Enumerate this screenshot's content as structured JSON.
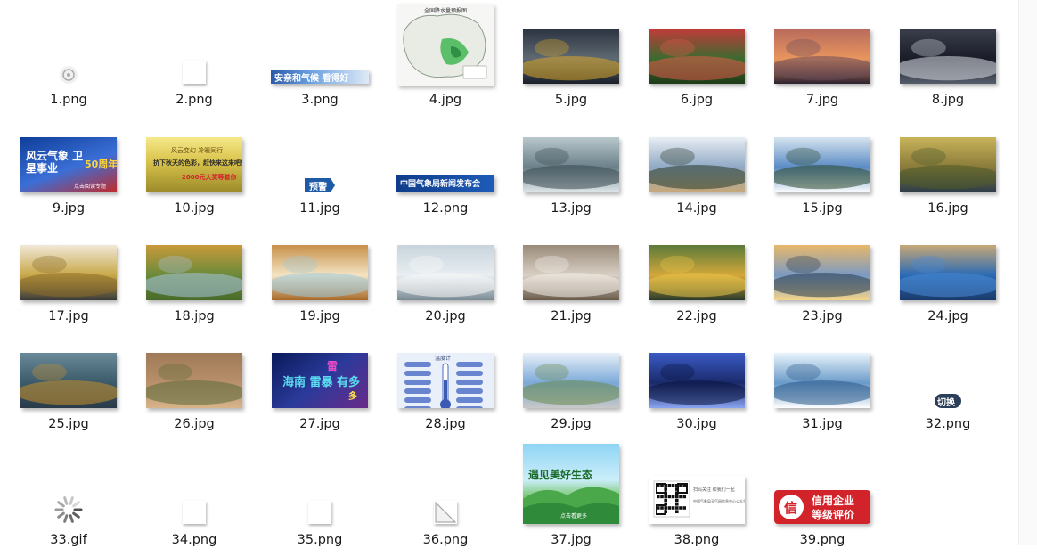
{
  "files": [
    {
      "name": "1.png",
      "kind": "icon-tiny"
    },
    {
      "name": "2.png",
      "kind": "blank-small"
    },
    {
      "name": "3.png",
      "kind": "banner-strip",
      "overlay_text": "安亲和气候 看得好"
    },
    {
      "name": "4.jpg",
      "kind": "map",
      "overlay_text": "全国降水量预报图"
    },
    {
      "name": "5.jpg",
      "kind": "photo",
      "palette": [
        "#5f6a72",
        "#2b3340",
        "#d9a628",
        "#1a1f28"
      ],
      "subject": "motorcycle-rider-yellow-hat"
    },
    {
      "name": "6.jpg",
      "kind": "photo",
      "palette": [
        "#3b6b2f",
        "#c23a3a",
        "#e35a4a",
        "#1f3b18"
      ],
      "subject": "red-berries-tree"
    },
    {
      "name": "7.jpg",
      "kind": "photo",
      "palette": [
        "#e8955e",
        "#b86a5c",
        "#6a4a5a",
        "#2c2230"
      ],
      "subject": "sunset-horses"
    },
    {
      "name": "8.jpg",
      "kind": "photo",
      "palette": [
        "#1a1d28",
        "#3a3f4c",
        "#d8dde4",
        "#555d6a"
      ],
      "subject": "satellite-clouds"
    },
    {
      "name": "9.jpg",
      "kind": "poster",
      "overlay_text": "风云气象 卫星事业",
      "overlay_text2": "50周年",
      "overlay_text3": "点击阅读专题"
    },
    {
      "name": "10.jpg",
      "kind": "poster",
      "overlay_text": "抗下秋天的色彩，赶快来这来吧！",
      "overlay_text2": "2000元大奖等着你",
      "overlay_text3": "风云变幻 冷暖同行"
    },
    {
      "name": "11.jpg",
      "kind": "badge",
      "overlay_text": "预警"
    },
    {
      "name": "12.png",
      "kind": "banner-blue",
      "overlay_text": "中国气象局新闻发布会"
    },
    {
      "name": "13.jpg",
      "kind": "photo",
      "palette": [
        "#6a7f8a",
        "#b8c8cc",
        "#3a4a50",
        "#e0e8ea"
      ],
      "subject": "misty-valley"
    },
    {
      "name": "14.jpg",
      "kind": "photo",
      "palette": [
        "#8fa8c4",
        "#e8eef4",
        "#2a3a28",
        "#c8a878"
      ],
      "subject": "sky-clouds-lake"
    },
    {
      "name": "15.jpg",
      "kind": "photo",
      "palette": [
        "#5a8ac4",
        "#d6e4f0",
        "#2d4a2a",
        "#ffffff"
      ],
      "subject": "blue-sky-clouds"
    },
    {
      "name": "16.jpg",
      "kind": "photo",
      "palette": [
        "#8a7a3a",
        "#c8b45a",
        "#4a5a2a",
        "#2a3a48"
      ],
      "subject": "rice-harvest"
    },
    {
      "name": "17.jpg",
      "kind": "photo",
      "palette": [
        "#c8a848",
        "#f0e8d8",
        "#8a6a28",
        "#3a3a3a"
      ],
      "subject": "tea-jar"
    },
    {
      "name": "18.jpg",
      "kind": "photo",
      "palette": [
        "#6a8a3a",
        "#c89a3a",
        "#a8c4e0",
        "#4a6a2a"
      ],
      "subject": "autumn-hills"
    },
    {
      "name": "19.jpg",
      "kind": "photo",
      "palette": [
        "#f4e4c4",
        "#c8904a",
        "#9cc8d8",
        "#a86a2a"
      ],
      "subject": "mooncakes"
    },
    {
      "name": "20.jpg",
      "kind": "photo",
      "palette": [
        "#e8eef2",
        "#c8d4dc",
        "#f8f8f8",
        "#7a8a94"
      ],
      "subject": "person-sneezing"
    },
    {
      "name": "21.jpg",
      "kind": "photo",
      "palette": [
        "#d8d0c4",
        "#9a8a7a",
        "#f4efe8",
        "#6a5a4a"
      ],
      "subject": "knit-and-coffee"
    },
    {
      "name": "22.jpg",
      "kind": "photo",
      "palette": [
        "#d4a83a",
        "#5a7a3a",
        "#e8c44a",
        "#2a3a2a"
      ],
      "subject": "autumn-leaves"
    },
    {
      "name": "23.jpg",
      "kind": "photo",
      "palette": [
        "#7a9ac4",
        "#e8b86a",
        "#2a3a4a",
        "#f4d48a"
      ],
      "subject": "golden-buddha"
    },
    {
      "name": "24.jpg",
      "kind": "photo",
      "palette": [
        "#2a6ab4",
        "#c8a878",
        "#4a8ad4",
        "#1a3a6a"
      ],
      "subject": "castle-lake"
    },
    {
      "name": "25.jpg",
      "kind": "photo",
      "palette": [
        "#3a5a6a",
        "#6a8a9a",
        "#c8902a",
        "#2a3a48"
      ],
      "subject": "flooded-pavilion"
    },
    {
      "name": "26.jpg",
      "kind": "photo",
      "palette": [
        "#b8906a",
        "#a07a58",
        "#5a6a3a",
        "#d8b48a"
      ],
      "subject": "dust-storm-tower"
    },
    {
      "name": "27.jpg",
      "kind": "poster",
      "overlay_text": "海南 雷暴 有多",
      "overlay_text2": "雷",
      "overlay_text3": "多"
    },
    {
      "name": "28.jpg",
      "kind": "infographic",
      "overlay_text": "温度计"
    },
    {
      "name": "29.jpg",
      "kind": "photo",
      "palette": [
        "#7aa8d8",
        "#e8f0f8",
        "#6a8a4a",
        "#c8c8c8"
      ],
      "subject": "greenhouses"
    },
    {
      "name": "30.jpg",
      "kind": "photo",
      "palette": [
        "#1a2a6a",
        "#3a5ac4",
        "#0a1440",
        "#8aa4f0"
      ],
      "subject": "conference-hall"
    },
    {
      "name": "31.jpg",
      "kind": "photo",
      "palette": [
        "#6a9ac8",
        "#e8f4fc",
        "#2a5a8a",
        "#ffffff"
      ],
      "subject": "sea-ice-sun"
    },
    {
      "name": "32.png",
      "kind": "pill-button",
      "overlay_text": "切换"
    },
    {
      "name": "33.gif",
      "kind": "spinner"
    },
    {
      "name": "34.png",
      "kind": "blank-small"
    },
    {
      "name": "35.png",
      "kind": "blank-small"
    },
    {
      "name": "36.png",
      "kind": "folded-page"
    },
    {
      "name": "37.jpg",
      "kind": "poster-eco",
      "overlay_text": "遇见美好生态",
      "overlay_text2": "点击看更多"
    },
    {
      "name": "38.png",
      "kind": "qr-card",
      "overlay_text": "扫码关注 和我们一起",
      "overlay_text2": "中国气象局天气网信息中心公众号"
    },
    {
      "name": "39.png",
      "kind": "credit-badge",
      "overlay_text": "信用企业",
      "overlay_text2": "等级评价",
      "overlay_text3": "信"
    }
  ],
  "colors": {
    "selection_bg": "#e5f3ff",
    "label_text": "#1a1a1a",
    "badge_blue": "#1f5aa6",
    "badge_red": "#d3232a"
  }
}
